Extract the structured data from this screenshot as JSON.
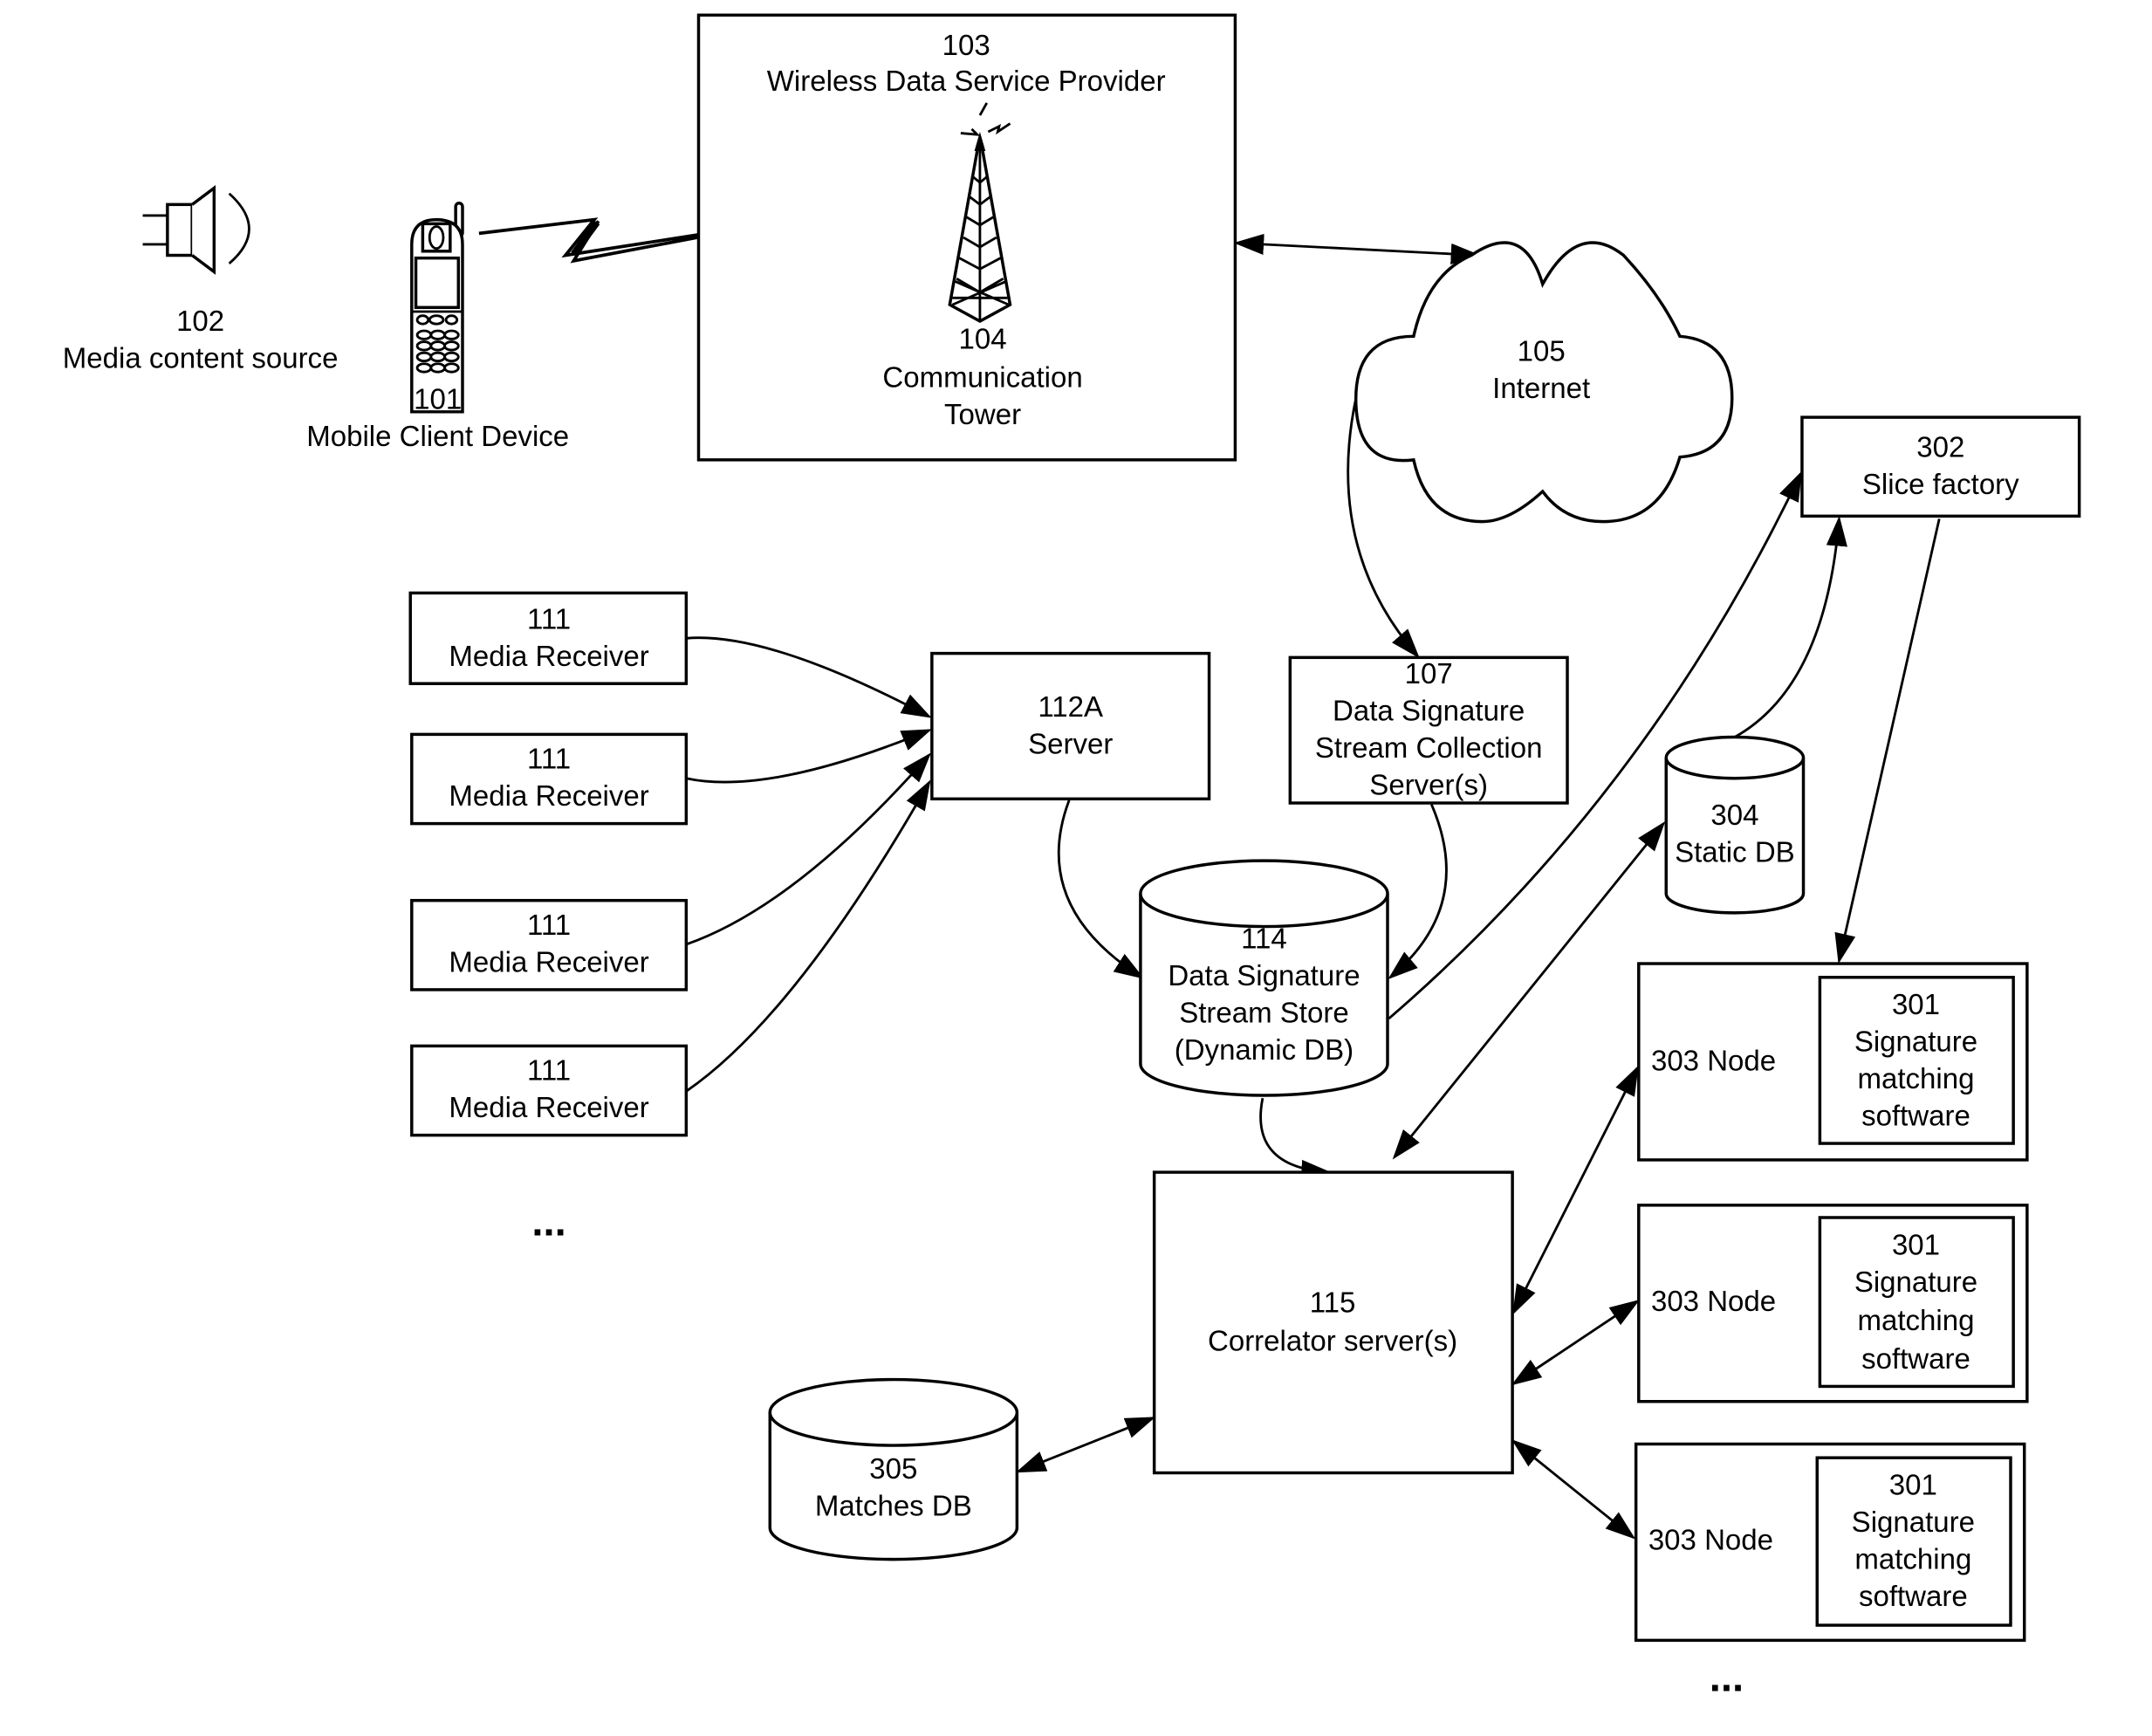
{
  "diagram": {
    "components": {
      "media_source": {
        "id": "102",
        "label": "Media content source",
        "icon": "speaker-icon"
      },
      "mobile_device": {
        "id": "101",
        "label": "Mobile Client Device",
        "icon": "mobile-phone-icon"
      },
      "wireless_provider": {
        "id": "103",
        "label": "Wireless Data Service Provider"
      },
      "tower": {
        "id": "104",
        "label_line1": "Communication",
        "label_line2": "Tower",
        "icon": "cell-tower-icon"
      },
      "internet": {
        "id": "105",
        "label": "Internet",
        "icon": "cloud-icon"
      },
      "collection_server": {
        "id": "107",
        "label_line1": "Data Signature",
        "label_line2": "Stream Collection",
        "label_line3": "Server(s)"
      },
      "media_receivers": [
        {
          "id": "111",
          "label": "Media Receiver"
        },
        {
          "id": "111",
          "label": "Media Receiver"
        },
        {
          "id": "111",
          "label": "Media Receiver"
        },
        {
          "id": "111",
          "label": "Media Receiver"
        }
      ],
      "receivers_more": "...",
      "server": {
        "id": "112A",
        "label": "Server"
      },
      "stream_store": {
        "id": "114",
        "label_line1": "Data Signature",
        "label_line2": "Stream Store",
        "label_line3": "(Dynamic DB)"
      },
      "correlator": {
        "id": "115",
        "label": "Correlator server(s)"
      },
      "slice_factory": {
        "id": "302",
        "label": "Slice factory"
      },
      "static_db": {
        "id": "304",
        "label": "Static DB"
      },
      "matches_db": {
        "id": "305",
        "label": "Matches DB"
      },
      "nodes": [
        {
          "id": "303",
          "label": "303 Node",
          "software": {
            "id": "301",
            "line1": "Signature",
            "line2": "matching",
            "line3": "software"
          }
        },
        {
          "id": "303",
          "label": "303 Node",
          "software": {
            "id": "301",
            "line1": "Signature",
            "line2": "matching",
            "line3": "software"
          }
        },
        {
          "id": "303",
          "label": "303 Node",
          "software": {
            "id": "301",
            "line1": "Signature",
            "line2": "matching",
            "line3": "software"
          }
        }
      ],
      "nodes_more": "..."
    },
    "connections": [
      {
        "from": "101",
        "to": "103",
        "type": "wireless"
      },
      {
        "from": "103",
        "to": "105",
        "type": "bidirectional"
      },
      {
        "from": "105",
        "to": "107",
        "type": "directed"
      },
      {
        "from": "111",
        "to": "112A",
        "type": "directed"
      },
      {
        "from": "112A",
        "to": "114",
        "type": "directed"
      },
      {
        "from": "107",
        "to": "114",
        "type": "directed"
      },
      {
        "from": "114",
        "to": "302",
        "type": "directed"
      },
      {
        "from": "304",
        "to": "302",
        "type": "directed"
      },
      {
        "from": "302",
        "to": "303",
        "type": "directed"
      },
      {
        "from": "304",
        "to": "115",
        "type": "bidirectional"
      },
      {
        "from": "114",
        "to": "115",
        "type": "directed"
      },
      {
        "from": "115",
        "to": "303",
        "type": "bidirectional"
      },
      {
        "from": "115",
        "to": "305",
        "type": "bidirectional"
      }
    ]
  }
}
